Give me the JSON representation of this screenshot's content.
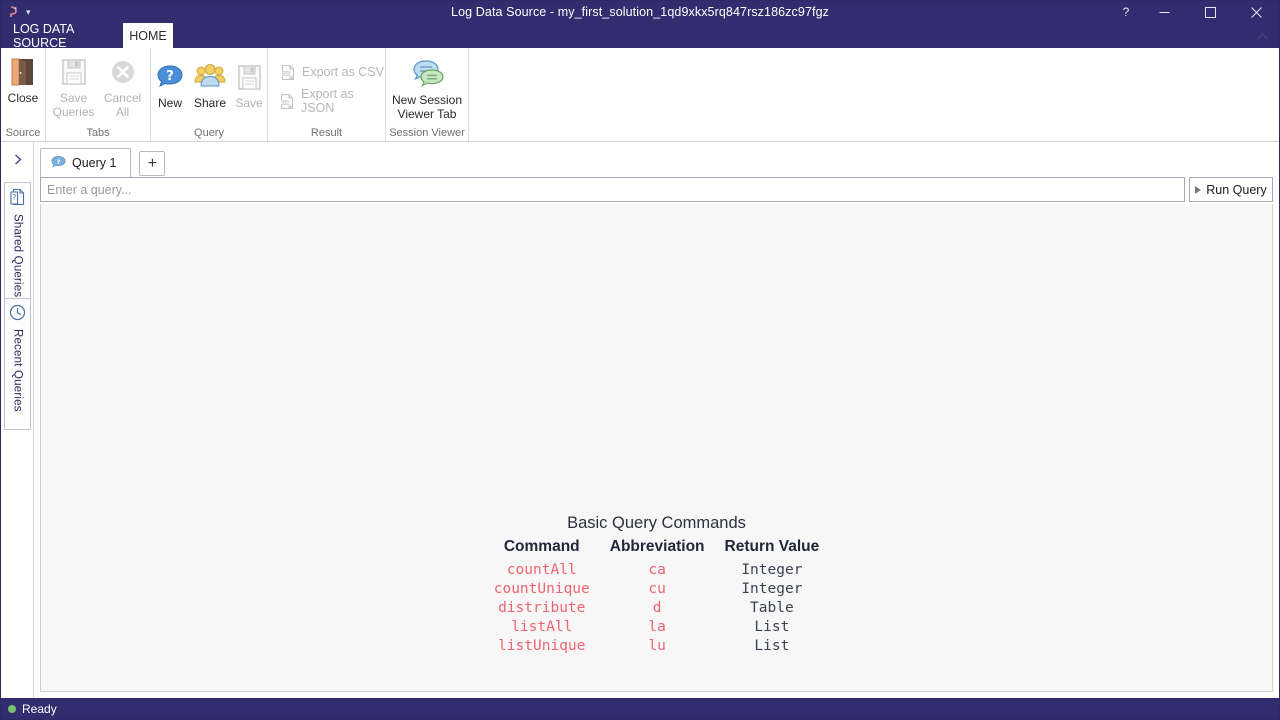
{
  "window": {
    "title": "Log Data Source - my_first_solution_1qd9xkx5rq847rsz186zc97fgz",
    "help_label": "?",
    "minimize_label": "minimize-icon",
    "maximize_label": "maximize-icon",
    "close_label": "close-icon",
    "ribbon_collapse_label": "chevron-up-icon",
    "qat_icon": "app-logo-icon",
    "qat_chevron": "▾"
  },
  "ribbon_tabs": {
    "file_tab": "LOG DATA SOURCE",
    "home_tab": "HOME"
  },
  "ribbon": {
    "groups": [
      {
        "name": "Source",
        "label": "Source",
        "buttons": [
          {
            "label": "Close",
            "icon": "open-door-icon",
            "disabled": false
          }
        ]
      },
      {
        "name": "Tabs",
        "label": "Tabs",
        "buttons": [
          {
            "label": "Save\nQueries",
            "line1": "Save",
            "line2": "Queries",
            "icon": "floppy-disk-icon",
            "disabled": true
          },
          {
            "label": "Cancel\nAll",
            "line1": "Cancel",
            "line2": "All",
            "icon": "cancel-circle-icon",
            "disabled": true
          }
        ]
      },
      {
        "name": "Query",
        "label": "Query",
        "buttons": [
          {
            "label": "New",
            "icon": "speech-bubble-question-icon",
            "disabled": false
          },
          {
            "label": "Share",
            "icon": "people-group-icon",
            "disabled": false
          },
          {
            "label": "Save",
            "icon": "floppy-disk-icon",
            "disabled": true
          }
        ]
      },
      {
        "name": "Result",
        "label": "Result",
        "buttons": [
          {
            "label": "Export as CSV",
            "icon": "csv-file-icon",
            "disabled": true
          },
          {
            "label": "Export as JSON",
            "icon": "json-file-icon",
            "disabled": true
          }
        ]
      },
      {
        "name": "Session Viewer",
        "label": "Session Viewer",
        "buttons": [
          {
            "line1": "New Session",
            "line2": "Viewer Tab",
            "icon": "two-speech-bubbles-icon",
            "disabled": false
          }
        ]
      }
    ]
  },
  "sidebar": {
    "expand_icon": "expand-panel-icon",
    "tabs": [
      {
        "label": "Shared Queries",
        "icon": "document-question-icon"
      },
      {
        "label": "Recent Queries",
        "icon": "clock-icon"
      }
    ]
  },
  "workspace": {
    "tabs": [
      {
        "label": "Query 1",
        "icon": "speech-bubble-question-icon"
      }
    ],
    "add_tab_label": "+",
    "query": {
      "value": "",
      "placeholder": "Enter a query...",
      "run_label": "Run Query"
    }
  },
  "result": {
    "title": "Basic Query Commands",
    "columns": [
      "Command",
      "Abbreviation",
      "Return Value"
    ],
    "rows": [
      [
        "countAll",
        "ca",
        "Integer"
      ],
      [
        "countUnique",
        "cu",
        "Integer"
      ],
      [
        "distribute",
        "d",
        "Table"
      ],
      [
        "listAll",
        "la",
        "List"
      ],
      [
        "listUnique",
        "lu",
        "List"
      ]
    ]
  },
  "statusbar": {
    "text": "Ready",
    "indicator": "green-status-dot"
  },
  "colors": {
    "chrome": "#312e70",
    "command_red": "#f0636f",
    "header_dark": "#21283a",
    "status_green": "#79c274",
    "pane_bg": "#f7f7f7"
  }
}
